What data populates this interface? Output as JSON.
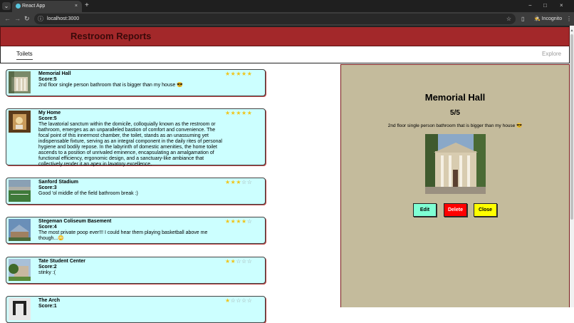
{
  "browser": {
    "tab_title": "React App",
    "tab_close": "×",
    "new_tab": "+",
    "url": "localhost:3000",
    "incognito_label": "Incognito",
    "window_controls": [
      "−",
      "□",
      "×"
    ]
  },
  "app": {
    "title": "Restroom Reports",
    "tabs": [
      {
        "label": "Toilets",
        "active": true
      },
      {
        "label": "Explore",
        "active": false
      }
    ]
  },
  "cards": [
    {
      "name": "Memorial Hall",
      "score_text": "Score:5",
      "score": 5,
      "description": "2nd floor single person bathroom that is bigger than my house 😎"
    },
    {
      "name": "My Home",
      "score_text": "Score:5",
      "score": 5,
      "description": "The lavatorial sanctum within the domicile, colloquially known as the restroom or bathroom, emerges as an unparalleled bastion of comfort and convenience. The focal point of this innermost chamber, the toilet, stands as an unassuming yet indispensable fixture, serving as an integral component in the daily rites of personal hygiene and bodily repose. In the labyrinth of domestic amenities, the home toilet ascends to a position of unrivaled eminence, encapsulating an amalgamation of functional efficiency, ergonomic design, and a sanctuary-like ambiance that collectively render it an apex in lavatory excellence."
    },
    {
      "name": "Sanford Stadium",
      "score_text": "Score:3",
      "score": 3,
      "description": "Good 'ol middle of the field bathroom break :)"
    },
    {
      "name": "Stegeman Coliseum Basement",
      "score_text": "Score:4",
      "score": 4,
      "description": "The most private poop ever!!! I could hear them playing basketball above me though...😳"
    },
    {
      "name": "Tate Student Center",
      "score_text": "Score:2",
      "score": 2,
      "description": "stinky :("
    },
    {
      "name": "The Arch",
      "score_text": "Score:1",
      "score": 1,
      "description": ""
    }
  ],
  "detail": {
    "title": "Memorial Hall",
    "score": "5/5",
    "description": "2nd floor single person bathroom that is bigger than my house 😎",
    "buttons": {
      "edit": "Edit",
      "delete": "Delete",
      "close": "Close"
    }
  },
  "colors": {
    "header_bg": "#a3282a",
    "card_bg": "#ccffff",
    "detail_bg": "#c4bb9c",
    "star_on": "#f0c419",
    "edit_btn": "#7fffd4",
    "delete_btn": "#ff0000",
    "close_btn": "#ffff00"
  },
  "icons": {
    "star_filled": "★",
    "star_empty": "☆"
  }
}
